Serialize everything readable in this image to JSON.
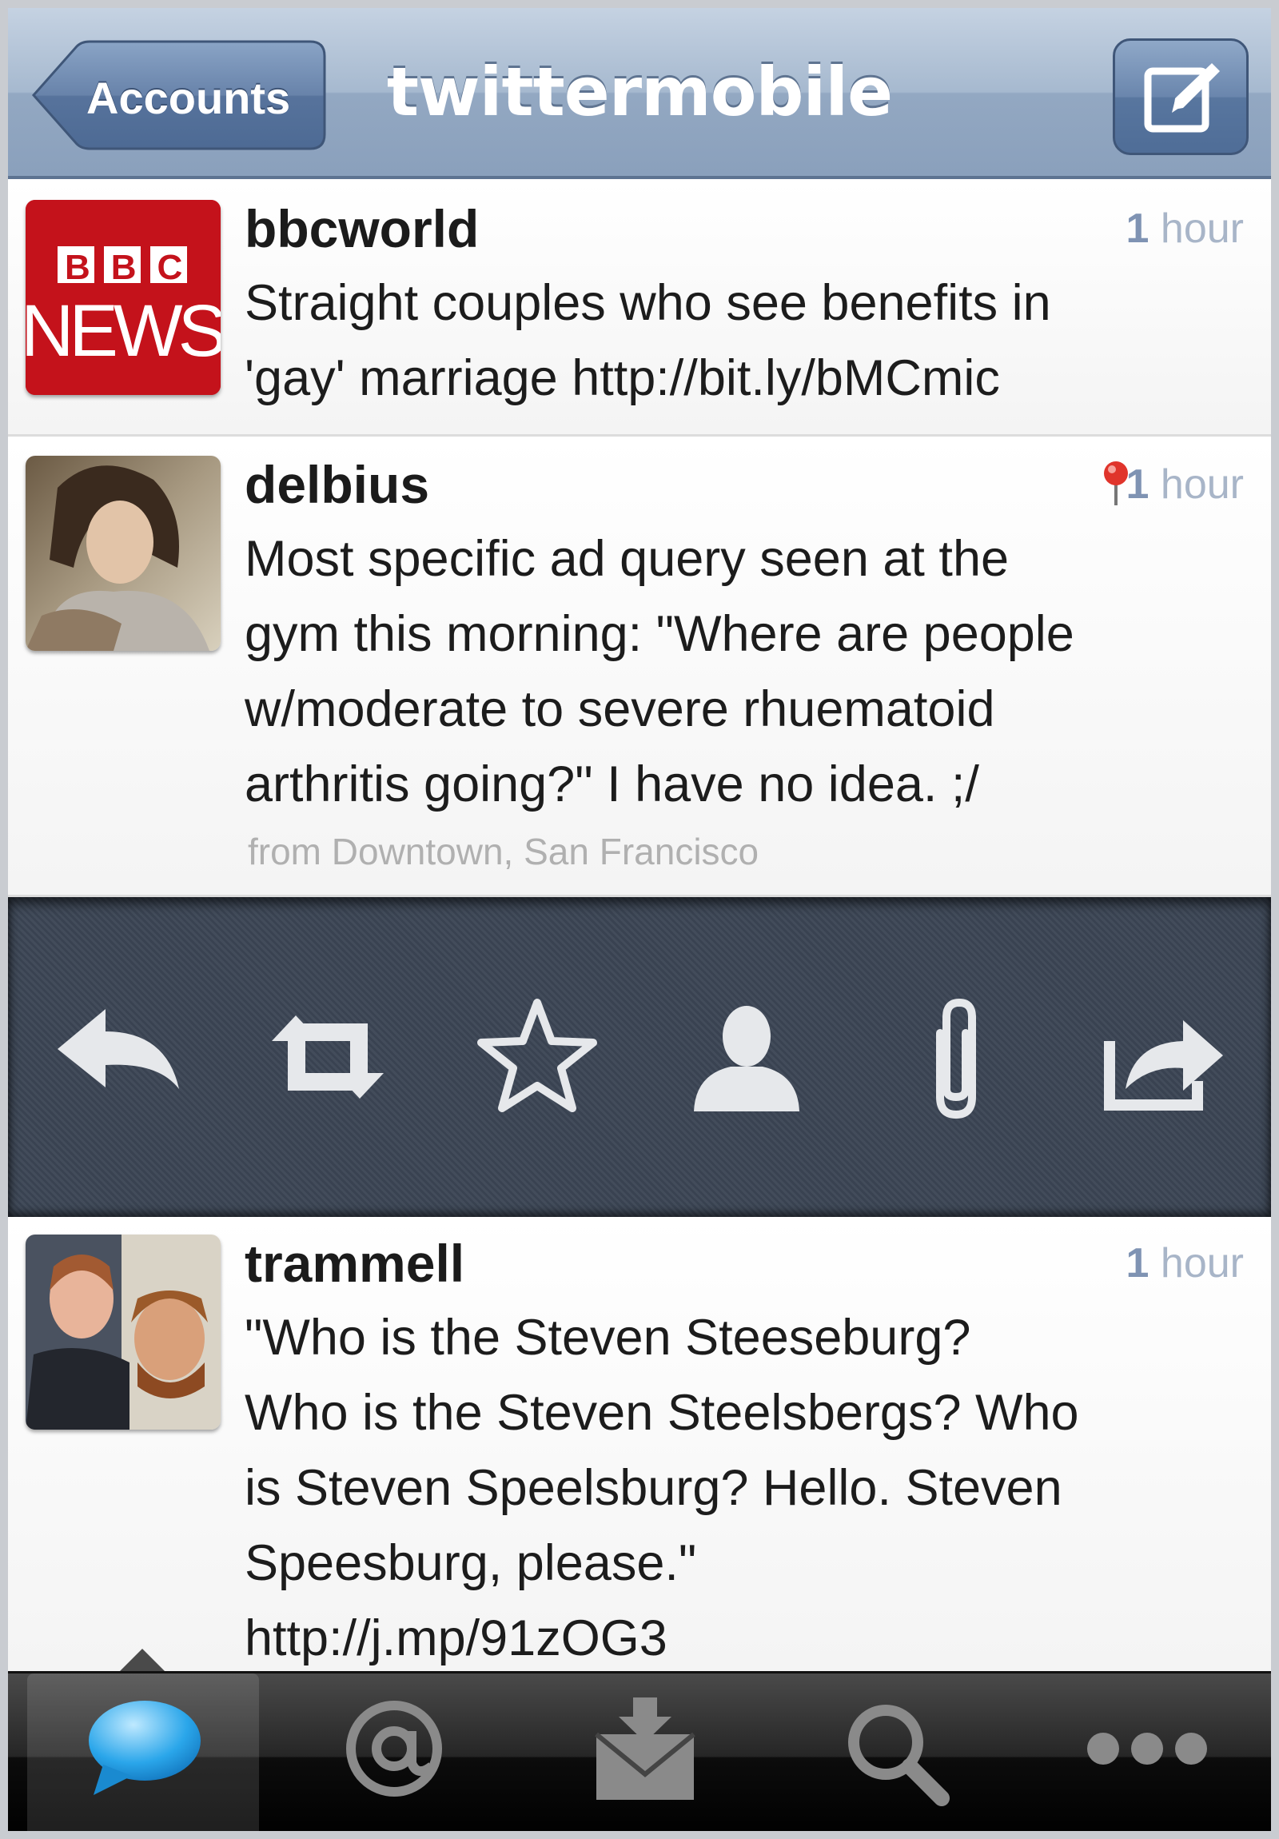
{
  "nav": {
    "title": "twittermobile",
    "back_label": "Accounts",
    "compose_icon": "compose-icon"
  },
  "tweets": [
    {
      "username": "bbcworld",
      "time_value": "1",
      "time_unit": "hour",
      "text_lines": [
        "Straight couples who see benefits in",
        "'gay' marriage http://bit.ly/bMCmic"
      ],
      "avatar": {
        "logo_top": "BBC",
        "logo_bottom": "NEWS",
        "color": "#c4121b"
      }
    },
    {
      "username": "delbius",
      "time_value": "1",
      "time_unit": "hour",
      "text_lines": [
        "Most specific ad query seen at the",
        "gym this morning: \"Where are people",
        "w/moderate to severe rhuematoid",
        "arthritis going?\" I have no idea. ;/"
      ],
      "from": "from Downtown, San Francisco",
      "has_location": true
    },
    {
      "username": "trammell",
      "time_value": "1",
      "time_unit": "hour",
      "text_lines": [
        "\"Who is the Steven Steeseburg?",
        "Who is the Steven Steelsbergs? Who",
        "is Steven Speelsburg? Hello. Steven",
        "Speesburg, please.\"",
        "http://j.mp/91zOG3"
      ]
    }
  ],
  "actions": [
    "reply-icon",
    "retweet-icon",
    "favorite-star-icon",
    "user-profile-icon",
    "attachment-paperclip-icon",
    "share-icon"
  ],
  "tabs": [
    "timeline-bubble-icon",
    "mentions-at-icon",
    "messages-inbox-icon",
    "search-icon",
    "more-dots-icon"
  ],
  "colors": {
    "navbar": "#9fb3cb",
    "link_blue": "#1a9ee0",
    "action_bg": "#3c4655"
  }
}
